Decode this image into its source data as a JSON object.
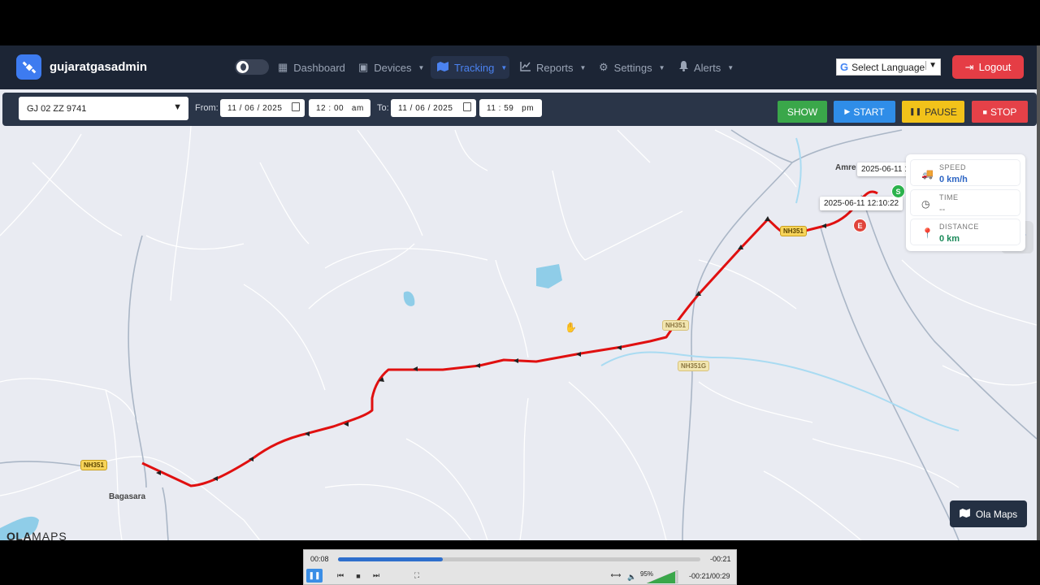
{
  "brand": {
    "name": "gujaratgasadmin"
  },
  "nav": {
    "items": [
      {
        "label": "Dashboard",
        "icon": "dashboard-icon"
      },
      {
        "label": "Devices",
        "icon": "chip-icon"
      },
      {
        "label": "Tracking",
        "icon": "map-icon",
        "active": true
      },
      {
        "label": "Reports",
        "icon": "chart-icon"
      },
      {
        "label": "Settings",
        "icon": "gear-icon"
      },
      {
        "label": "Alerts",
        "icon": "bell-icon"
      }
    ],
    "language": "Select Language",
    "logout": "Logout"
  },
  "controls": {
    "vehicle": "GJ 02 ZZ 9741",
    "from_label": "From:",
    "from_date": "11 / 06 / 2025",
    "from_time": "12 : 00   am",
    "to_label": "To:",
    "to_date": "11 / 06 / 2025",
    "to_time": "11 : 59   pm",
    "show": "SHOW",
    "start": "START",
    "pause": "PAUSE",
    "stop": "STOP"
  },
  "info": {
    "speed_label": "SPEED",
    "speed_value": "0 km/h",
    "time_label": "TIME",
    "time_value": "--",
    "distance_label": "DISTANCE",
    "distance_value": "0 km"
  },
  "map": {
    "tooltip1": "2025-06-11 1",
    "tooltip2": "2025-06-11 12:10:22",
    "start_marker": "S",
    "end_marker": "E",
    "city_amreli": "Amre",
    "city_bagasara": "Bagasara",
    "badge_nh351_left": "NH351",
    "badge_nh351_mid": "NH351",
    "badge_nh351g": "NH351G",
    "badge_nh351_top": "NH351",
    "ola_maps_button": "Ola Maps",
    "ola_logo_a": "OLA",
    "ola_logo_b": "MAPS",
    "route_color": "#e01010"
  },
  "player": {
    "elapsed": "00:08",
    "remaining": "-00:21",
    "progress": 0.29,
    "volume": "95%",
    "time_total": "-00:21/00:29"
  }
}
